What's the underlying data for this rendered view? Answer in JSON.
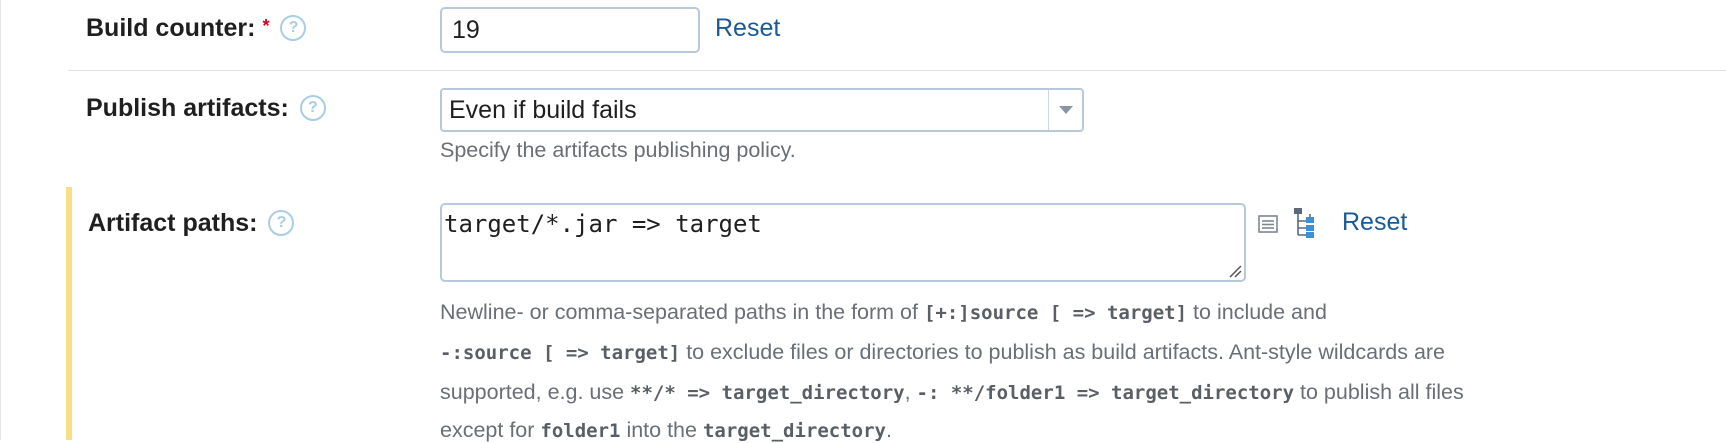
{
  "build_counter": {
    "label": "Build counter:",
    "required_mark": "*",
    "help_icon": "question-circle-icon",
    "value": "19",
    "reset_label": "Reset"
  },
  "publish_artifacts": {
    "label": "Publish artifacts:",
    "help_icon": "question-circle-icon",
    "selected": "Even if build fails",
    "hint": "Specify the artifacts publishing policy."
  },
  "artifact_paths": {
    "label": "Artifact paths:",
    "help_icon": "question-circle-icon",
    "value": "target/*.jar => target",
    "editor_icon": "list-editor-icon",
    "tree_icon": "tree-browse-icon",
    "reset_label": "Reset",
    "hint": {
      "t1": "Newline- or comma-separated paths in the form of ",
      "c1": "[+:]source [ => target]",
      "t2": " to include and",
      "c2": "-:source [ => target]",
      "t3": " to exclude files or directories to publish as build artifacts. Ant-style wildcards are",
      "t4": "supported, e.g. use ",
      "c3": "**/* => target_directory",
      "t5": ", ",
      "c4": "-: **/folder1 => target_directory",
      "t6": " to publish all files",
      "t7": "except for ",
      "c5": "folder1",
      "t8": " into the ",
      "c6": "target_directory",
      "t9": "."
    }
  },
  "colors": {
    "link": "#1a5a96",
    "required": "#d0021b",
    "help": "#a9cde6",
    "highlight": "#f8df85"
  }
}
